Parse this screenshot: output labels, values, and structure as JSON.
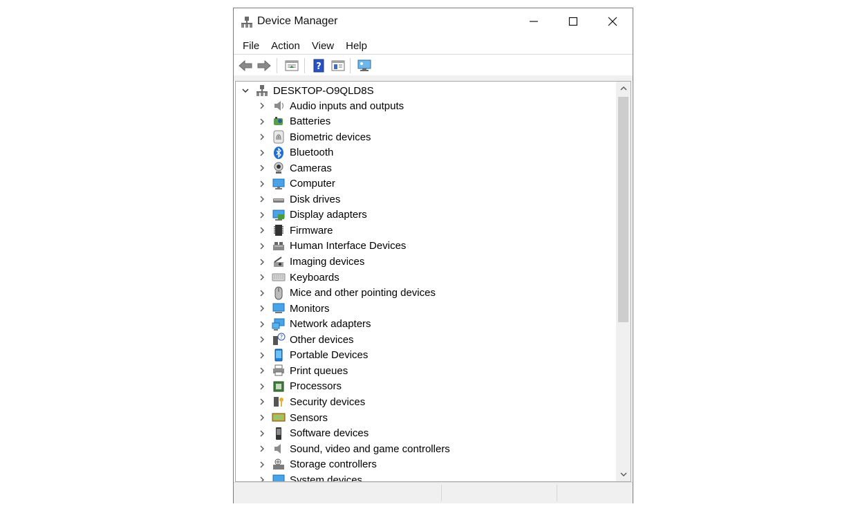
{
  "window": {
    "title": "Device Manager"
  },
  "menu": [
    "File",
    "Action",
    "View",
    "Help"
  ],
  "toolbar": {
    "icons": [
      "back-arrow-icon",
      "forward-arrow-icon",
      "properties-icon",
      "help-icon",
      "update-driver-icon",
      "scan-hardware-icon"
    ]
  },
  "tree": {
    "root": "DESKTOP-O9QLD8S",
    "items": [
      {
        "label": "Audio inputs and outputs",
        "icon": "speaker-icon"
      },
      {
        "label": "Batteries",
        "icon": "battery-icon"
      },
      {
        "label": "Biometric devices",
        "icon": "fingerprint-icon"
      },
      {
        "label": "Bluetooth",
        "icon": "bluetooth-icon"
      },
      {
        "label": "Cameras",
        "icon": "camera-icon"
      },
      {
        "label": "Computer",
        "icon": "computer-icon"
      },
      {
        "label": "Disk drives",
        "icon": "disk-drive-icon"
      },
      {
        "label": "Display adapters",
        "icon": "display-adapter-icon"
      },
      {
        "label": "Firmware",
        "icon": "firmware-icon"
      },
      {
        "label": "Human Interface Devices",
        "icon": "hid-icon"
      },
      {
        "label": "Imaging devices",
        "icon": "imaging-icon"
      },
      {
        "label": "Keyboards",
        "icon": "keyboard-icon"
      },
      {
        "label": "Mice and other pointing devices",
        "icon": "mouse-icon"
      },
      {
        "label": "Monitors",
        "icon": "monitor-icon"
      },
      {
        "label": "Network adapters",
        "icon": "network-adapter-icon"
      },
      {
        "label": "Other devices",
        "icon": "unknown-device-icon"
      },
      {
        "label": "Portable Devices",
        "icon": "portable-device-icon"
      },
      {
        "label": "Print queues",
        "icon": "printer-icon"
      },
      {
        "label": "Processors",
        "icon": "processor-icon"
      },
      {
        "label": "Security devices",
        "icon": "security-device-icon"
      },
      {
        "label": "Sensors",
        "icon": "sensor-icon"
      },
      {
        "label": "Software devices",
        "icon": "software-device-icon"
      },
      {
        "label": "Sound, video and game controllers",
        "icon": "sound-controller-icon"
      },
      {
        "label": "Storage controllers",
        "icon": "storage-controller-icon"
      },
      {
        "label": "System devices",
        "icon": "system-device-icon"
      }
    ]
  }
}
